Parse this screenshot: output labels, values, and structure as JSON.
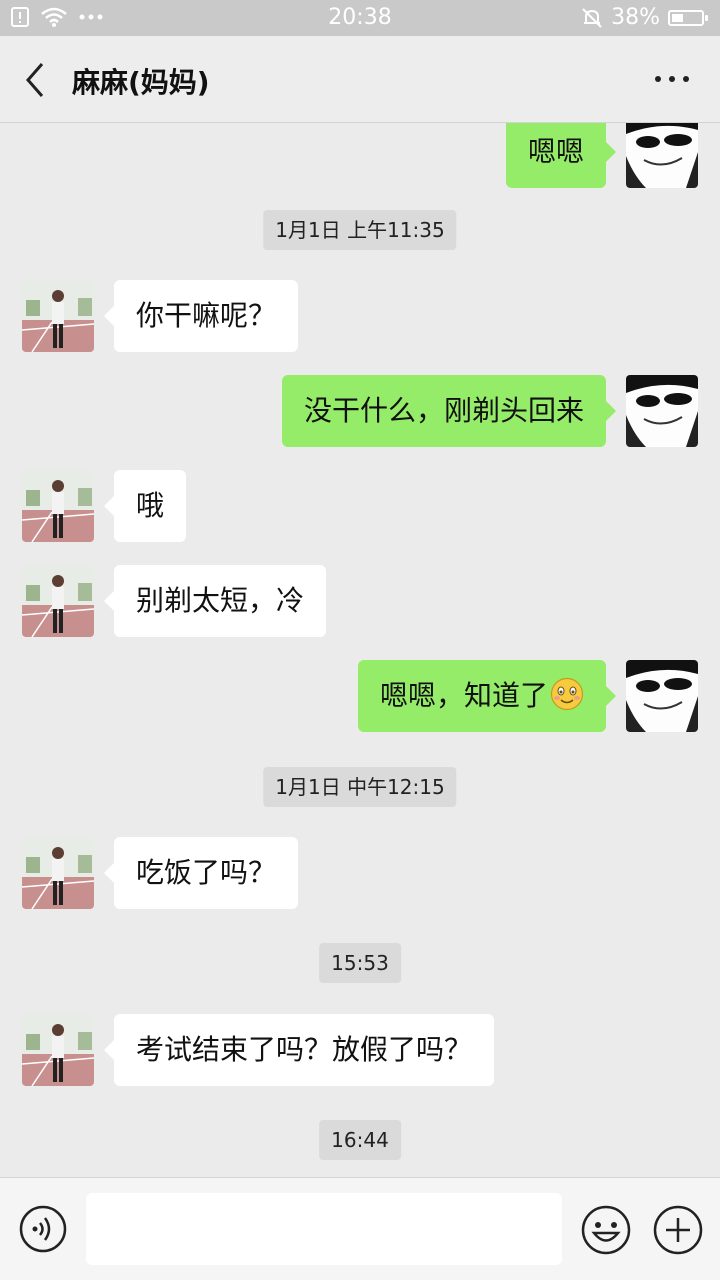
{
  "status_bar": {
    "time": "20:38",
    "battery": "38%",
    "battery_level": 0.38
  },
  "header": {
    "back_icon": "chevron-left-icon",
    "title": "麻麻(妈妈)",
    "more_icon": "more-dots-icon"
  },
  "messages": [
    {
      "from": "me",
      "text": "嗯嗯"
    },
    {
      "type": "time",
      "text": "1月1日 上午11:35"
    },
    {
      "from": "mom",
      "text": "你干嘛呢？"
    },
    {
      "from": "me",
      "text": "没干什么，刚剃头回来"
    },
    {
      "from": "mom",
      "text": "哦"
    },
    {
      "from": "mom",
      "text": "别剃太短，冷"
    },
    {
      "from": "me",
      "text": "嗯嗯，知道了",
      "emoji": "smile-emoji"
    },
    {
      "type": "time",
      "text": "1月1日 中午12:15"
    },
    {
      "from": "mom",
      "text": "吃饭了吗？"
    },
    {
      "type": "time",
      "text": "15:53"
    },
    {
      "from": "mom",
      "text": "考试结束了吗？放假了吗？"
    },
    {
      "type": "time",
      "text": "16:44"
    }
  ],
  "input_bar": {
    "voice_icon": "voice-icon",
    "input_value": "",
    "emoji_icon": "emoji-icon",
    "plus_icon": "plus-icon"
  },
  "colors": {
    "my_bubble": "#95ec69",
    "their_bubble": "#ffffff",
    "chat_bg": "#ebebeb"
  }
}
